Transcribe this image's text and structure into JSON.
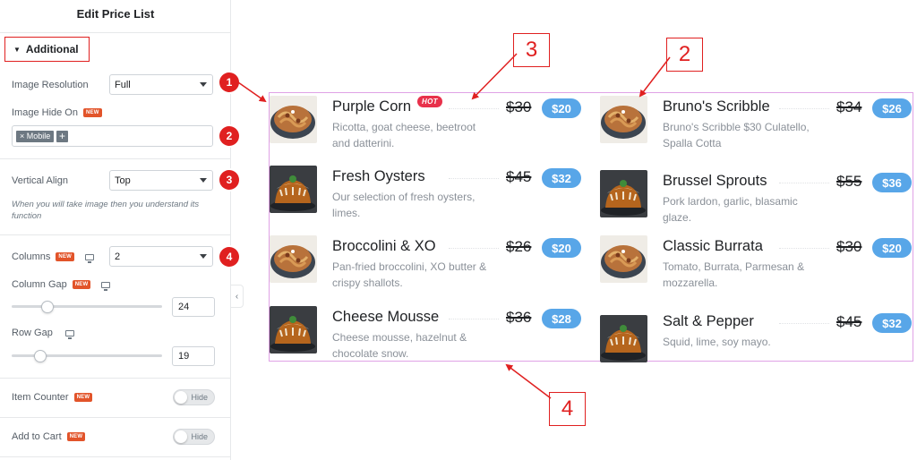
{
  "sidebar": {
    "title": "Edit Price List",
    "section_label": "Additional",
    "new_badge": "NEW",
    "image_resolution": {
      "label": "Image Resolution",
      "value": "Full"
    },
    "image_hide_on": {
      "label": "Image Hide On",
      "tag": "× Mobile",
      "add": "+"
    },
    "vertical_align": {
      "label": "Vertical Align",
      "value": "Top",
      "note": "When you will take image then you understand its function"
    },
    "columns": {
      "label": "Columns",
      "value": "2"
    },
    "column_gap": {
      "label": "Column Gap",
      "value": "24",
      "level": 0.24
    },
    "row_gap": {
      "label": "Row Gap",
      "value": "19",
      "level": 0.19
    },
    "item_counter": {
      "label": "Item Counter",
      "state": "Hide"
    },
    "add_to_cart": {
      "label": "Add to Cart",
      "state": "Hide"
    },
    "collapse_icon": "‹"
  },
  "badges": [
    "1",
    "2",
    "3",
    "4"
  ],
  "callouts": [
    "3",
    "2",
    "4"
  ],
  "hot_label": "HOT",
  "menu": {
    "left": [
      {
        "name": "Purple Corn",
        "desc": "Ricotta, goat cheese, beetroot and datterini.",
        "old": "$30",
        "price": "$20",
        "img": "pasta"
      },
      {
        "name": "Fresh Oysters",
        "desc": "Our selection of fresh oysters, limes.",
        "old": "$45",
        "price": "$32",
        "img": "cake"
      },
      {
        "name": "Broccolini & XO",
        "desc": "Pan-fried broccolini, XO butter & crispy shallots.",
        "old": "$26",
        "price": "$20",
        "img": "pasta"
      },
      {
        "name": "Cheese Mousse",
        "desc": "Cheese mousse, hazelnut & chocolate snow.",
        "old": "$36",
        "price": "$28",
        "img": "cake"
      }
    ],
    "right": [
      {
        "name": "Bruno's Scribble",
        "desc": "Bruno's Scribble $30 Culatello, Spalla Cotta",
        "old": "$34",
        "price": "$26",
        "img": "pasta"
      },
      {
        "name": "Brussel Sprouts",
        "desc": "Pork lardon, garlic, blasamic glaze.",
        "old": "$55",
        "price": "$36",
        "img": "cake"
      },
      {
        "name": "Classic Burrata",
        "desc": "Tomato, Burrata, Parmesan & mozzarella.",
        "old": "$30",
        "price": "$20",
        "img": "pasta"
      },
      {
        "name": "Salt & Pepper",
        "desc": "Squid, lime, soy mayo.",
        "old": "$45",
        "price": "$32",
        "img": "cake"
      }
    ]
  },
  "colors": {
    "accent": "#e02020",
    "price_pill": "#58a6e8",
    "hot": "#e8314b",
    "new_badge": "#e2542a",
    "preview_border": "#e0a2e6"
  }
}
